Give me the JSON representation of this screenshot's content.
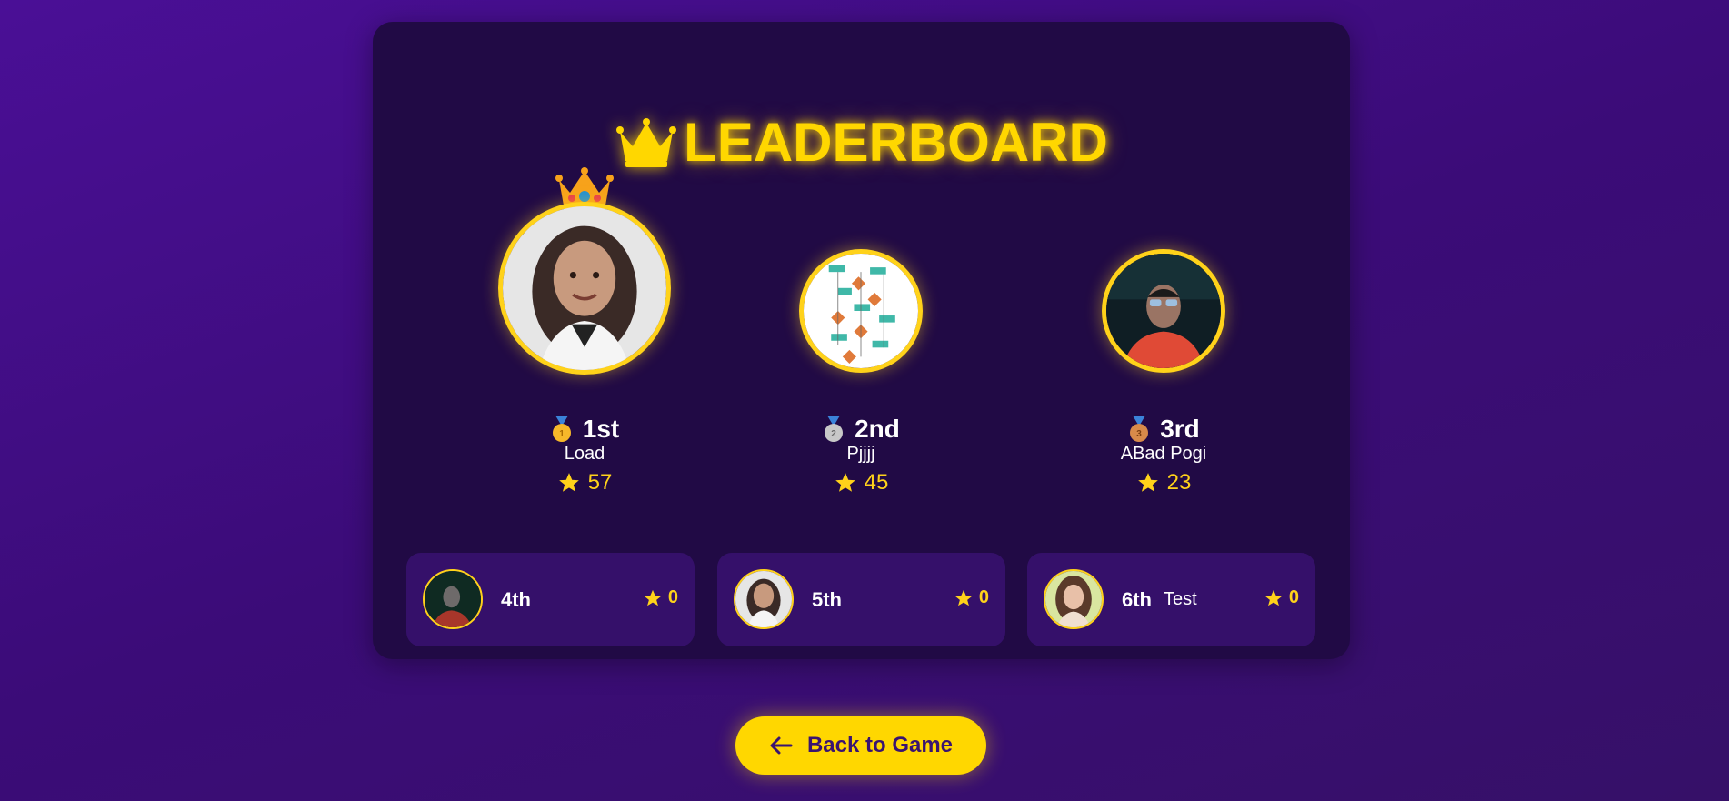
{
  "title": {
    "text": "LEADERBOARD",
    "icon": "crown-icon",
    "color": "#ffd700"
  },
  "podium": [
    {
      "rank": "1st",
      "name": "Load",
      "score": "57",
      "medal": "gold-medal-icon",
      "medal_number": "1",
      "has_crown": true
    },
    {
      "rank": "2nd",
      "name": "Pjjjj",
      "score": "45",
      "medal": "silver-medal-icon",
      "medal_number": "2",
      "has_crown": false
    },
    {
      "rank": "3rd",
      "name": "ABad Pogi",
      "score": "23",
      "medal": "bronze-medal-icon",
      "medal_number": "3",
      "has_crown": false
    }
  ],
  "others": [
    {
      "rank": "4th",
      "name": "",
      "score": "0"
    },
    {
      "rank": "5th",
      "name": "",
      "score": "0"
    },
    {
      "rank": "6th",
      "name": "Test",
      "score": "0"
    }
  ],
  "back_button": {
    "label": "Back to Game",
    "icon": "arrow-left-icon"
  },
  "colors": {
    "background": "#3f0d80",
    "card": "#210a45",
    "row_card": "#35106a",
    "accent": "#ffd700",
    "text": "#ffffff"
  }
}
